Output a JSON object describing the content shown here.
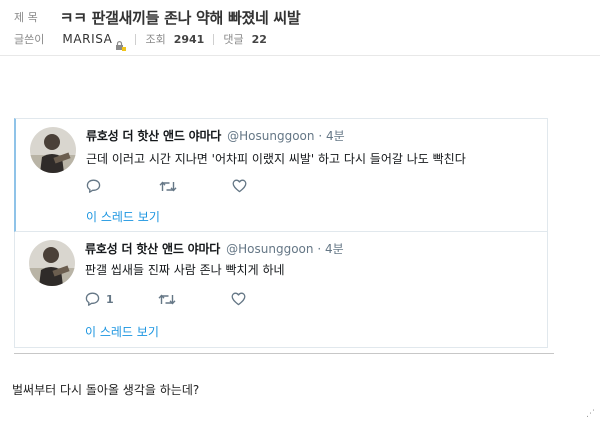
{
  "post": {
    "title_label": "제 목",
    "title": "ㅋㅋ 판갤새끼들 존나 약해 빠졌네 씨발",
    "author_label": "글쓴이",
    "author": "MARISA",
    "views_label": "조회",
    "views": "2941",
    "comments_label": "댓글",
    "comments": "22"
  },
  "tweets": [
    {
      "name": "류호성 더 핫산 앤드 야마다",
      "handle": "@Hosunggoon · 4분",
      "text": "근데 이러고 시간 지나면 '어차피 이랬지 씨발' 하고 다시 들어갈 나도 빡친다",
      "reply_count": "",
      "thread_link": "이 스레드 보기"
    },
    {
      "name": "류호성 더 핫산 앤드 야마다",
      "handle": "@Hosunggoon · 4분",
      "text": "판갤 씹새들 진짜 사람 존나 빡치게 하네",
      "reply_count": "1",
      "thread_link": "이 스레드 보기"
    }
  ],
  "comment": "벌써부터 다시 돌아올 생각을 하는데?",
  "corner_mark": "⋰",
  "icons": [
    "lock-badge-icon",
    "reply-icon",
    "retweet-icon",
    "like-icon"
  ],
  "colors": {
    "link": "#1b95e0",
    "icon": "#657786",
    "border": "#e1e8ed",
    "highlight": "#8fc3e8"
  }
}
